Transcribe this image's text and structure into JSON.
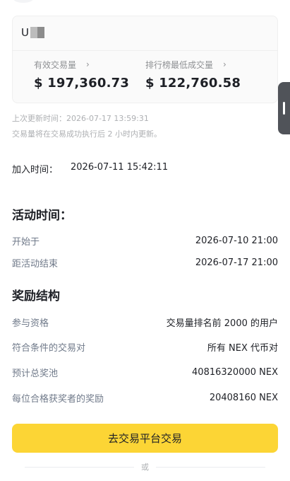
{
  "account": {
    "uid_prefix": "U"
  },
  "stats": {
    "volume_label": "有效交易量",
    "volume_value": "$ 197,360.73",
    "min_label": "排行榜最低成交量",
    "min_value": "$ 122,760.58",
    "chevron_icon": "chevron-right-icon"
  },
  "notes": {
    "last_updated": "上次更新时间：2026-07-17 13:59:31",
    "update_info": "交易量将在交易成功执行后 2 小时内更新。"
  },
  "join": {
    "label": "加入时间：",
    "value": "2026-07-11 15:42:11"
  },
  "activity": {
    "title": "活动时间：",
    "start_label": "开始于",
    "start_value": "2026-07-10 21:00",
    "end_label": "距活动结束",
    "end_value": "2026-07-17 21:00"
  },
  "rewards": {
    "title": "奖励结构",
    "rows": [
      {
        "label": "参与资格",
        "value": "交易量排名前 2000 的用户"
      },
      {
        "label": "符合条件的交易对",
        "value": "所有 NEX 代币对"
      },
      {
        "label": "预计总奖池",
        "value": "40816320000 NEX"
      },
      {
        "label": "每位合格获奖者的奖励",
        "value": "20408160 NEX"
      }
    ]
  },
  "cta": {
    "label": "去交易平台交易"
  },
  "divider": {
    "or_text": "或"
  },
  "colors": {
    "accent": "#fcd535",
    "text_primary": "#1e2026",
    "text_secondary": "#707a8a"
  }
}
